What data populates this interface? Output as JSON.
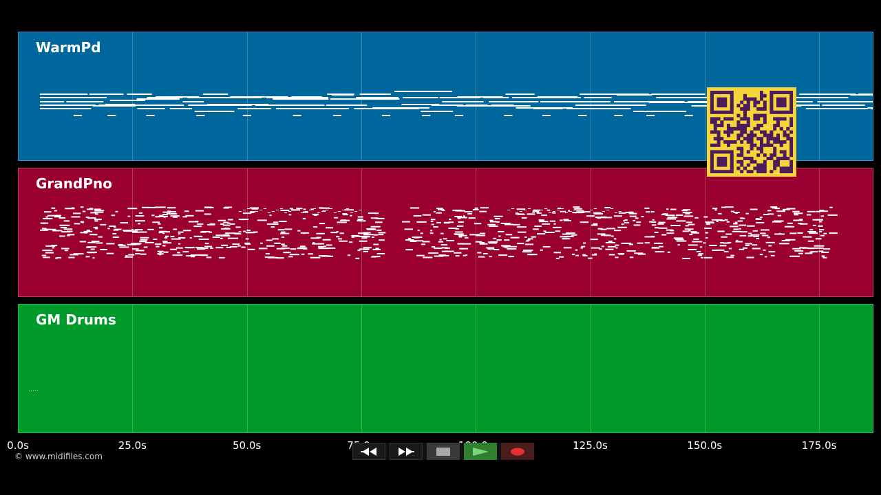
{
  "colors": {
    "background": "#000000",
    "track_warmpd": "#00679c",
    "track_grandpno": "#990030",
    "track_gmdrums": "#009a2b",
    "qr_background": "#f5d53a",
    "qr_foreground": "#4b1b5c"
  },
  "tracks": [
    {
      "name": "WarmPd",
      "color": "#00679c"
    },
    {
      "name": "GrandPno",
      "color": "#990030"
    },
    {
      "name": "GM Drums",
      "color": "#009a2b"
    }
  ],
  "timeline": {
    "ticks": [
      "0.0s",
      "25.0s",
      "50.0s",
      "75.0s",
      "100.0s",
      "125.0s",
      "150.0s",
      "175.0s"
    ]
  },
  "footer": {
    "copyright": "© www.midifiles.com"
  },
  "transport": {
    "rewind_icon": "rewind-icon",
    "fast_forward_icon": "fast-forward-icon",
    "stop_icon": "stop-icon",
    "play_icon": "play-icon",
    "record_icon": "record-icon"
  }
}
